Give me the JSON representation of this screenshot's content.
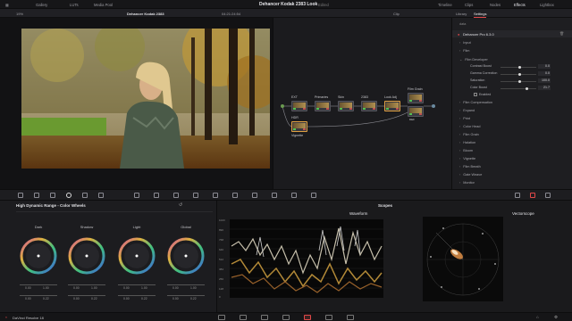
{
  "topbar": {
    "gallery": "Gallery",
    "luts": "LUTs",
    "media_pool": "Media Pool",
    "project_title": "Dehancer Kodak 2383 Look",
    "edited": "Edited",
    "timeline": "Timeline",
    "clips": "Clips",
    "nodes": "Nodes",
    "effects": "Effects",
    "lightbox": "Lightbox"
  },
  "secbar": {
    "zoom": "19%",
    "clip_name": "Dehancer Kodak 2383",
    "timecode": "04:21:24:54",
    "clip_mode": "Clip",
    "library": "Library",
    "settings": "Settings"
  },
  "viewer": {
    "timecode": "00:00:12:23"
  },
  "nodegraph": {
    "nodes": [
      {
        "num": "01",
        "label": "EXT"
      },
      {
        "num": "02",
        "label": "Primaries"
      },
      {
        "num": "03",
        "label": "Skin"
      },
      {
        "num": "04",
        "label": "2383"
      },
      {
        "num": "05",
        "label": "Look Adj"
      },
      {
        "num": "06",
        "label": "Film Grain"
      },
      {
        "num": "07",
        "label": "DEF"
      },
      {
        "num": "08",
        "label": "HDR"
      },
      {
        "num": "09",
        "label": "Vignette"
      }
    ]
  },
  "settings": {
    "section": "data",
    "plugin": "Dehancer Pro 6.3.0",
    "rows": [
      "Input",
      "Film",
      "Film Developer"
    ],
    "params": [
      {
        "label": "Contrast Boost",
        "value": "0.0"
      },
      {
        "label": "Gamma Correction",
        "value": "0.0"
      },
      {
        "label": "Saturation",
        "value": "100.0"
      },
      {
        "label": "Color Boost",
        "value": "21.7"
      }
    ],
    "enabled": "Enabled",
    "rows2": [
      "Film Compensation",
      "Expand",
      "Print",
      "Color Head",
      "Film Grain",
      "Halation",
      "Bloom",
      "Vignette",
      "Film Breath",
      "Gate Weave",
      "Monitor"
    ]
  },
  "wheels": {
    "title": "High Dynamic Range - Color Wheels",
    "labels": [
      "Dark",
      "Shadow",
      "Light",
      "Global"
    ],
    "vals_a": [
      "0.00",
      "0.00",
      "0.00",
      "0.00"
    ],
    "vals_b": [
      "1.00",
      "1.00",
      "1.00",
      "1.00"
    ],
    "vals_c": [
      "0.00",
      "0.00",
      "0.00",
      "0.00"
    ],
    "vals_d": [
      "0.22",
      "0.22",
      "0.22",
      "0.22"
    ]
  },
  "scopes": {
    "title": "Scopes",
    "waveform": "Waveform",
    "vectorscope": "Vectorscope",
    "scale": [
      "1023",
      "896",
      "768",
      "640",
      "512",
      "384",
      "256",
      "128",
      "0"
    ]
  },
  "bottombar": {
    "app": "DaVinci Resolve 18"
  },
  "colors": {
    "accent": "#e04848",
    "node_green": "#52c052"
  }
}
